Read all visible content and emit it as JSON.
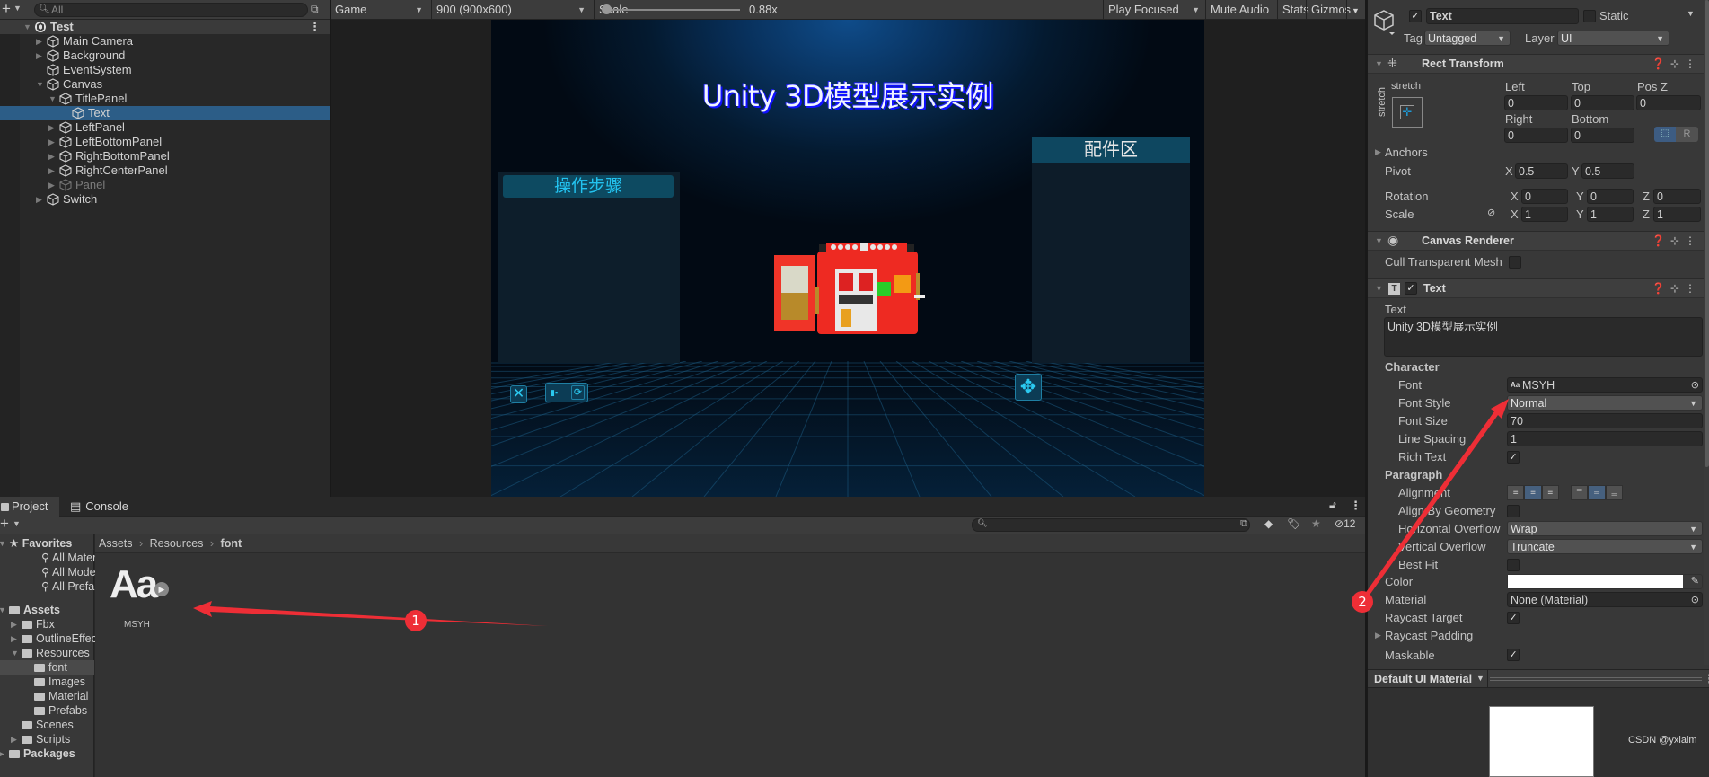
{
  "hierarchy": {
    "search_placeholder": "All",
    "rows": [
      {
        "label": "Test",
        "depth": 0,
        "expand": "open",
        "kind": "scene"
      },
      {
        "label": "Main Camera",
        "depth": 1,
        "expand": "closed"
      },
      {
        "label": "Background",
        "depth": 1,
        "expand": "closed"
      },
      {
        "label": "EventSystem",
        "depth": 1,
        "expand": "none"
      },
      {
        "label": "Canvas",
        "depth": 1,
        "expand": "open"
      },
      {
        "label": "TitlePanel",
        "depth": 2,
        "expand": "open"
      },
      {
        "label": "Text",
        "depth": 3,
        "expand": "none",
        "selected": true
      },
      {
        "label": "LeftPanel",
        "depth": 2,
        "expand": "closed"
      },
      {
        "label": "LeftBottomPanel",
        "depth": 2,
        "expand": "closed"
      },
      {
        "label": "RightBottomPanel",
        "depth": 2,
        "expand": "closed"
      },
      {
        "label": "RightCenterPanel",
        "depth": 2,
        "expand": "closed"
      },
      {
        "label": "Panel",
        "depth": 2,
        "expand": "closed",
        "inactive": true
      },
      {
        "label": "Switch",
        "depth": 1,
        "expand": "closed"
      }
    ]
  },
  "game_toolbar": {
    "display": "Game",
    "resolution": "900 (900x600)",
    "scale_label": "Scale",
    "scale_value": "0.88x",
    "play_mode": "Play Focused",
    "mute_audio": "Mute Audio",
    "stats": "Stats",
    "gizmos": "Gizmos"
  },
  "game_view": {
    "title": "Unity 3D模型展示实例",
    "left_panel_title": "操作步骤",
    "right_panel_title": "配件区"
  },
  "inspector": {
    "object_name": "Text",
    "active": true,
    "static_label": "Static",
    "tag_label": "Tag",
    "tag_value": "Untagged",
    "layer_label": "Layer",
    "layer_value": "UI",
    "rect_transform": {
      "title": "Rect Transform",
      "anchor_preset_h": "stretch",
      "anchor_preset_v": "stretch",
      "left_label": "Left",
      "left": "0",
      "top_label": "Top",
      "top": "0",
      "posz_label": "Pos Z",
      "posz": "0",
      "right_label": "Right",
      "right": "0",
      "bottom_label": "Bottom",
      "bottom": "0",
      "raw_edit_label": "R",
      "anchors_label": "Anchors",
      "pivot_label": "Pivot",
      "pivot_x": "0.5",
      "pivot_y": "0.5",
      "rotation_label": "Rotation",
      "rot_x": "0",
      "rot_y": "0",
      "rot_z": "0",
      "scale_label": "Scale",
      "scale_x": "1",
      "scale_y": "1",
      "scale_z": "1"
    },
    "canvas_renderer": {
      "title": "Canvas Renderer",
      "cull_label": "Cull Transparent Mesh",
      "cull": false
    },
    "text_component": {
      "title": "Text",
      "enabled": true,
      "text_label": "Text",
      "text_value": "Unity 3D模型展示实例",
      "character_label": "Character",
      "font_label": "Font",
      "font_value": "MSYH",
      "font_style_label": "Font Style",
      "font_style_value": "Normal",
      "font_size_label": "Font Size",
      "font_size_value": "70",
      "line_spacing_label": "Line Spacing",
      "line_spacing_value": "1",
      "rich_text_label": "Rich Text",
      "rich_text": true,
      "paragraph_label": "Paragraph",
      "alignment_label": "Alignment",
      "alignment_h": "center",
      "alignment_v": "middle",
      "align_geom_label": "Align By Geometry",
      "align_geom": false,
      "h_overflow_label": "Horizontal Overflow",
      "h_overflow_value": "Wrap",
      "v_overflow_label": "Vertical Overflow",
      "v_overflow_value": "Truncate",
      "best_fit_label": "Best Fit",
      "best_fit": false,
      "color_label": "Color",
      "color_value": "#ffffff",
      "material_label": "Material",
      "material_value": "None (Material)",
      "raycast_target_label": "Raycast Target",
      "raycast_target": true,
      "raycast_padding_label": "Raycast Padding",
      "maskable_label": "Maskable",
      "maskable": true
    },
    "material_preview": {
      "title": "Default UI Material"
    },
    "watermark": "CSDN @yxlalm"
  },
  "project": {
    "tabs": [
      {
        "label": "Project",
        "active": true
      },
      {
        "label": "Console",
        "active": false
      }
    ],
    "hidden_count": "12",
    "tree": [
      {
        "label": "Favorites",
        "kind": "favorites",
        "depth": 0,
        "expand": "open",
        "bold": true
      },
      {
        "label": "All Materials",
        "kind": "search",
        "depth": 1
      },
      {
        "label": "All Models",
        "kind": "search",
        "depth": 1
      },
      {
        "label": "All Prefabs",
        "kind": "search",
        "depth": 1
      },
      {
        "label": "Assets",
        "kind": "folder-open",
        "depth": 0,
        "expand": "open",
        "bold": true
      },
      {
        "label": "Fbx",
        "kind": "folder",
        "depth": 1,
        "expand": "closed"
      },
      {
        "label": "OutlineEffect",
        "kind": "folder",
        "depth": 1,
        "expand": "closed"
      },
      {
        "label": "Resources",
        "kind": "folder-open",
        "depth": 1,
        "expand": "open"
      },
      {
        "label": "font",
        "kind": "folder",
        "depth": 2,
        "selected": true
      },
      {
        "label": "Images",
        "kind": "folder",
        "depth": 2
      },
      {
        "label": "Material",
        "kind": "folder",
        "depth": 2
      },
      {
        "label": "Prefabs",
        "kind": "folder",
        "depth": 2
      },
      {
        "label": "Scenes",
        "kind": "folder",
        "depth": 1
      },
      {
        "label": "Scripts",
        "kind": "folder",
        "depth": 1,
        "expand": "closed"
      },
      {
        "label": "Packages",
        "kind": "folder",
        "depth": 0,
        "expand": "closed",
        "bold": true
      }
    ],
    "breadcrumb": [
      "Assets",
      "Resources",
      "font"
    ],
    "assets": [
      {
        "name": "MSYH",
        "type": "font",
        "glyph": "Aa"
      }
    ]
  },
  "annotations": [
    {
      "number": "1",
      "color": "#ee2e36"
    },
    {
      "number": "2",
      "color": "#ee2e36"
    }
  ]
}
